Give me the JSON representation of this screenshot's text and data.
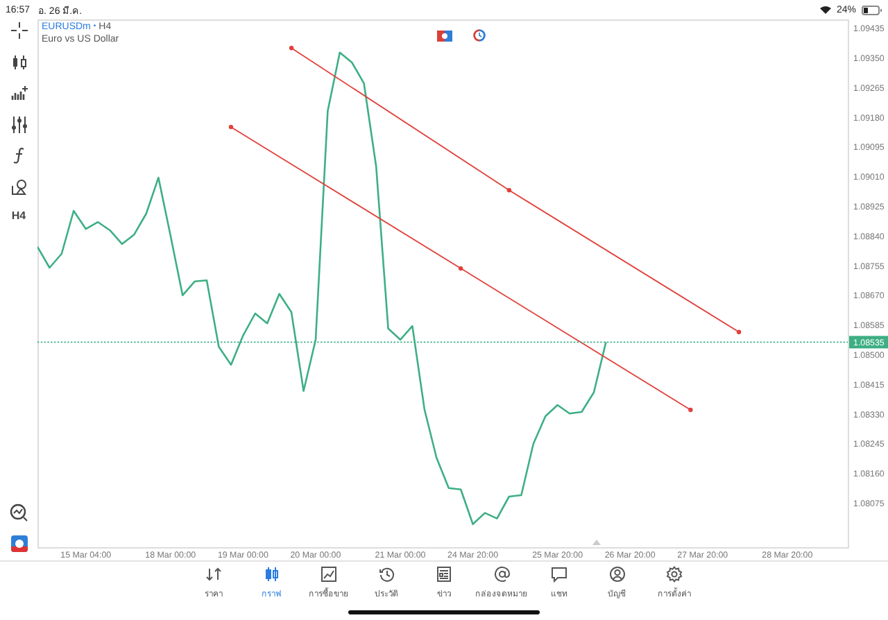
{
  "status_bar": {
    "time": "16:57",
    "date": "อ. 26 มี.ค.",
    "battery": "24%"
  },
  "toolbar": {
    "timeframe": "H4"
  },
  "symbol": {
    "name": "EURUSDm",
    "separator": "•",
    "timeframe": "H4",
    "description": "Euro vs US Dollar"
  },
  "chart": {
    "chart_data": {
      "type": "line",
      "categories": [
        null,
        null,
        null,
        null,
        "15 Mar 04:00",
        null,
        null,
        null,
        null,
        null,
        null,
        "18 Mar 00:00",
        null,
        null,
        null,
        null,
        null,
        "19 Mar 00:00",
        null,
        null,
        null,
        null,
        null,
        "20 Mar 00:00",
        null,
        null,
        null,
        null,
        null,
        null,
        "21 Mar 00:00",
        null,
        null,
        null,
        null,
        null,
        "24 Mar 20:00",
        null,
        null,
        null,
        null,
        null,
        null,
        "25 Mar 20:00",
        null,
        null,
        null,
        null,
        null,
        "26 Mar 20:00",
        null,
        null,
        null,
        null,
        null,
        "27 Mar 20:00",
        null,
        null,
        null,
        null,
        null,
        null,
        "28 Mar 20:00",
        null,
        null,
        null,
        null,
        null
      ],
      "series": [
        {
          "color": "#3daf84",
          "values": [
            1.08808,
            1.08748,
            1.08788,
            1.08911,
            1.08859,
            1.08879,
            1.08855,
            1.08816,
            1.08843,
            1.08903,
            1.09006,
            1.0884,
            1.08669,
            1.08709,
            1.08712,
            1.08522,
            1.0847,
            1.08554,
            1.08617,
            1.08589,
            1.08673,
            1.08621,
            1.08395,
            1.08542,
            1.09197,
            1.09364,
            1.09336,
            1.09276,
            1.09038,
            1.08574,
            1.08542,
            1.08581,
            1.08343,
            1.08204,
            1.08117,
            1.08113,
            1.08014,
            1.08046,
            1.0803,
            1.08093,
            1.08097,
            1.08244,
            1.08323,
            1.08355,
            1.08331,
            1.08335,
            1.08391,
            1.08535,
            null,
            null,
            null,
            null,
            null,
            null,
            null,
            null,
            null,
            null,
            null,
            null,
            null,
            null,
            null,
            null,
            null,
            null,
            null,
            null
          ]
        },
        {
          "color": "#e0403a",
          "marker": true,
          "values": [
            null,
            null,
            null,
            null,
            null,
            null,
            null,
            null,
            null,
            null,
            null,
            null,
            null,
            null,
            null,
            null,
            null,
            null,
            null,
            null,
            null,
            1.09377,
            null,
            null,
            null,
            null,
            null,
            null,
            null,
            null,
            null,
            null,
            null,
            null,
            null,
            null,
            null,
            null,
            null,
            1.0897,
            null,
            null,
            null,
            null,
            null,
            null,
            null,
            null,
            null,
            null,
            null,
            null,
            null,
            null,
            null,
            null,
            null,
            null,
            1.08564,
            null,
            null,
            null,
            null,
            null,
            null,
            null,
            null,
            null
          ]
        },
        {
          "color": "#e0403a",
          "marker": true,
          "values": [
            null,
            null,
            null,
            null,
            null,
            null,
            null,
            null,
            null,
            null,
            null,
            null,
            null,
            null,
            null,
            null,
            1.09151,
            null,
            null,
            null,
            null,
            null,
            null,
            null,
            null,
            null,
            null,
            null,
            null,
            null,
            null,
            null,
            null,
            null,
            null,
            1.08746,
            null,
            null,
            null,
            null,
            null,
            null,
            null,
            null,
            null,
            null,
            null,
            null,
            null,
            null,
            null,
            null,
            null,
            null,
            1.08341,
            null,
            null,
            null,
            null,
            null,
            null,
            null,
            null,
            null,
            null,
            null,
            null,
            null
          ]
        }
      ],
      "ylim": [
        1.07946,
        1.09459
      ],
      "yticks": [
        {
          "value": 1.09435,
          "label": "1.09435"
        },
        {
          "value": 1.0935,
          "label": "1.09350"
        },
        {
          "value": 1.09265,
          "label": "1.09265"
        },
        {
          "value": 1.0918,
          "label": "1.09180"
        },
        {
          "value": 1.09095,
          "label": "1.09095"
        },
        {
          "value": 1.0901,
          "label": "1.09010"
        },
        {
          "value": 1.08925,
          "label": "1.08925"
        },
        {
          "value": 1.0884,
          "label": "1.08840"
        },
        {
          "value": 1.08755,
          "label": "1.08755"
        },
        {
          "value": 1.0867,
          "label": "1.08670"
        },
        {
          "value": 1.08585,
          "label": "1.08585"
        },
        {
          "value": 1.085,
          "label": "1.08500"
        },
        {
          "value": 1.08415,
          "label": "1.08415"
        },
        {
          "value": 1.0833,
          "label": "1.08330"
        },
        {
          "value": 1.08245,
          "label": "1.08245"
        },
        {
          "value": 1.0816,
          "label": "1.08160"
        },
        {
          "value": 1.08075,
          "label": "1.08075"
        }
      ],
      "ref_lines": [
        {
          "axis": "y",
          "value": 1.08535,
          "label": "1.08535",
          "color": "#3daf84"
        }
      ]
    }
  },
  "nav": [
    {
      "label": "ราคา",
      "selected": false
    },
    {
      "label": "กราฟ",
      "selected": true
    },
    {
      "label": "การซื้อขาย",
      "selected": false
    },
    {
      "label": "ประวัติ",
      "selected": false
    },
    {
      "label": "ข่าว",
      "selected": false
    },
    {
      "label": "กล่องจดหมาย",
      "selected": false
    },
    {
      "label": "แชท",
      "selected": false
    },
    {
      "label": "บัญชี",
      "selected": false
    },
    {
      "label": "การตั้งค่า",
      "selected": false
    }
  ]
}
